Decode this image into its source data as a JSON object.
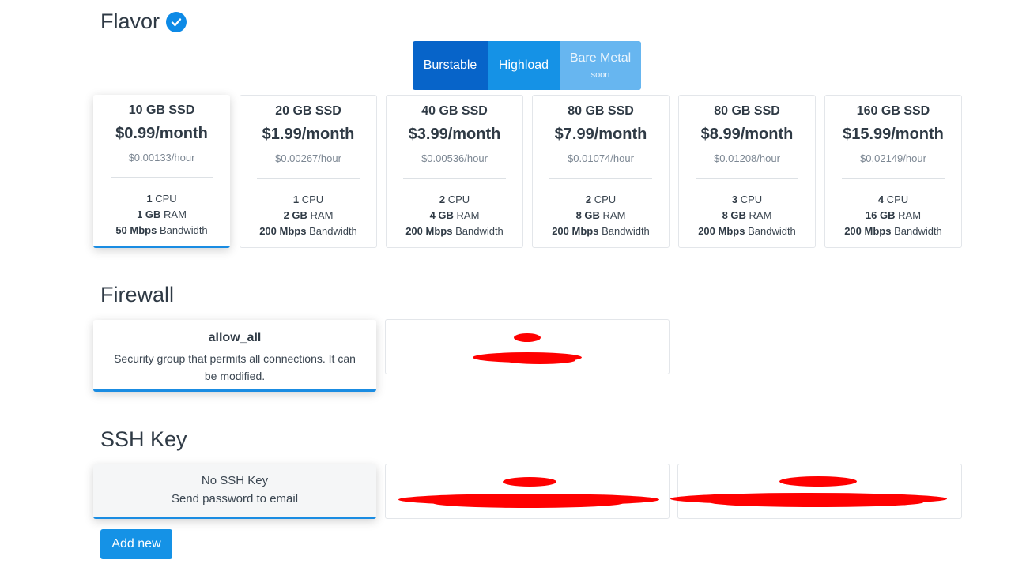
{
  "flavor": {
    "title": "Flavor",
    "tabs": [
      {
        "label": "Burstable",
        "sub": ""
      },
      {
        "label": "Highload",
        "sub": ""
      },
      {
        "label": "Bare Metal",
        "sub": "soon"
      }
    ],
    "plans": [
      {
        "size": "10 GB SSD",
        "price": "$0.99/month",
        "hour": "$0.00133/hour",
        "cpu": "1",
        "cpu_unit": "CPU",
        "ram": "1 GB",
        "ram_unit": "RAM",
        "bw": "50 Mbps",
        "bw_unit": "Bandwidth"
      },
      {
        "size": "20 GB SSD",
        "price": "$1.99/month",
        "hour": "$0.00267/hour",
        "cpu": "1",
        "cpu_unit": "CPU",
        "ram": "2 GB",
        "ram_unit": "RAM",
        "bw": "200 Mbps",
        "bw_unit": "Bandwidth"
      },
      {
        "size": "40 GB SSD",
        "price": "$3.99/month",
        "hour": "$0.00536/hour",
        "cpu": "2",
        "cpu_unit": "CPU",
        "ram": "4 GB",
        "ram_unit": "RAM",
        "bw": "200 Mbps",
        "bw_unit": "Bandwidth"
      },
      {
        "size": "80 GB SSD",
        "price": "$7.99/month",
        "hour": "$0.01074/hour",
        "cpu": "2",
        "cpu_unit": "CPU",
        "ram": "8 GB",
        "ram_unit": "RAM",
        "bw": "200 Mbps",
        "bw_unit": "Bandwidth"
      },
      {
        "size": "80 GB SSD",
        "price": "$8.99/month",
        "hour": "$0.01208/hour",
        "cpu": "3",
        "cpu_unit": "CPU",
        "ram": "8 GB",
        "ram_unit": "RAM",
        "bw": "200 Mbps",
        "bw_unit": "Bandwidth"
      },
      {
        "size": "160 GB SSD",
        "price": "$15.99/month",
        "hour": "$0.02149/hour",
        "cpu": "4",
        "cpu_unit": "CPU",
        "ram": "16 GB",
        "ram_unit": "RAM",
        "bw": "200 Mbps",
        "bw_unit": "Bandwidth"
      }
    ]
  },
  "firewall": {
    "title": "Firewall",
    "groups": [
      {
        "name": "allow_all",
        "description": "Security group that permits all connections. It can be modified."
      }
    ]
  },
  "ssh": {
    "title": "SSH Key",
    "no_key_line1": "No SSH Key",
    "no_key_line2": "Send password to email",
    "add_new": "Add new"
  },
  "colors": {
    "primary": "#1592e6",
    "primary_dark": "#0764c9",
    "primary_light": "#67b6f0",
    "redaction": "#ff0000"
  }
}
